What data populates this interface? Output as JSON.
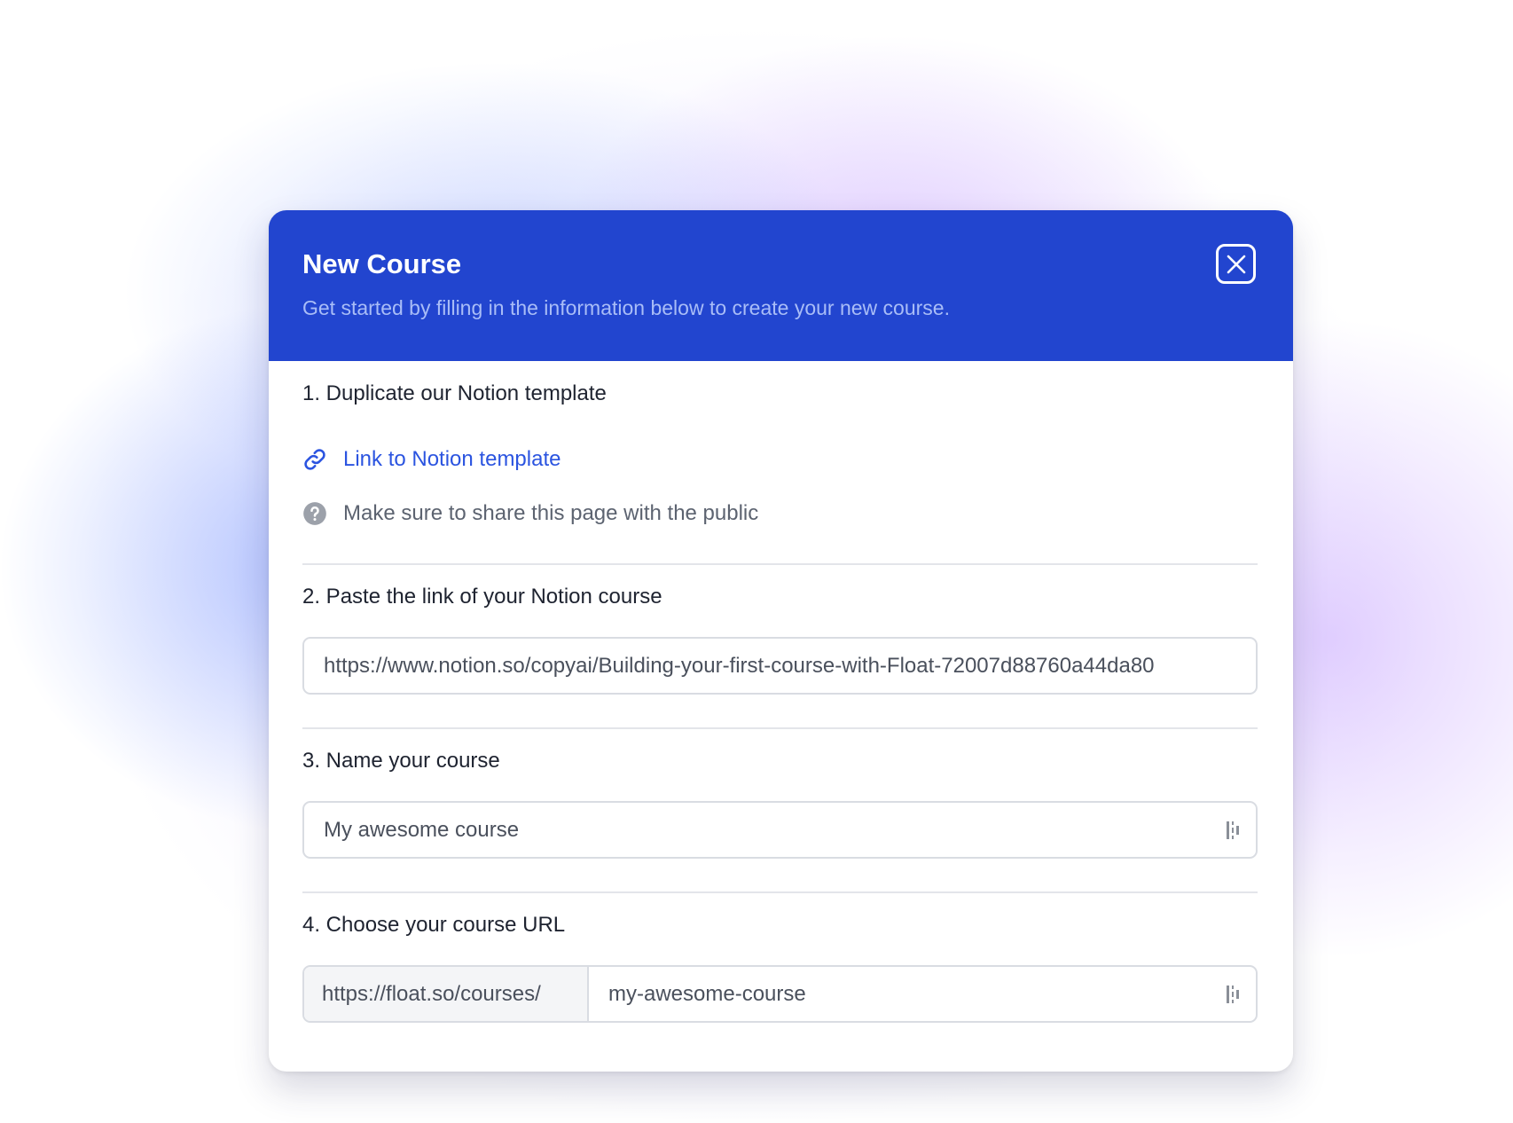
{
  "modal": {
    "title": "New Course",
    "subtitle": "Get started by filling in the information below to create your new course."
  },
  "steps": {
    "duplicate": {
      "label": "1. Duplicate our Notion template",
      "link_text": "Link to Notion template",
      "hint_text": "Make sure to share this page with the public"
    },
    "paste_link": {
      "label": "2. Paste the link of your Notion course",
      "value": "https://www.notion.so/copyai/Building-your-first-course-with-Float-72007d88760a44da80"
    },
    "name": {
      "label": "3. Name your course",
      "value": "My awesome course"
    },
    "url": {
      "label": "4. Choose your course URL",
      "prefix": "https://float.so/courses/",
      "value": "my-awesome-course"
    }
  },
  "icons": {
    "close": "close-icon",
    "link": "link-icon",
    "help": "question-circle-icon",
    "field_extension": "grammar-extension-icon"
  },
  "colors": {
    "header": "#2245cf",
    "link": "#2b54e0",
    "subtitle": "#a9bdf7"
  }
}
